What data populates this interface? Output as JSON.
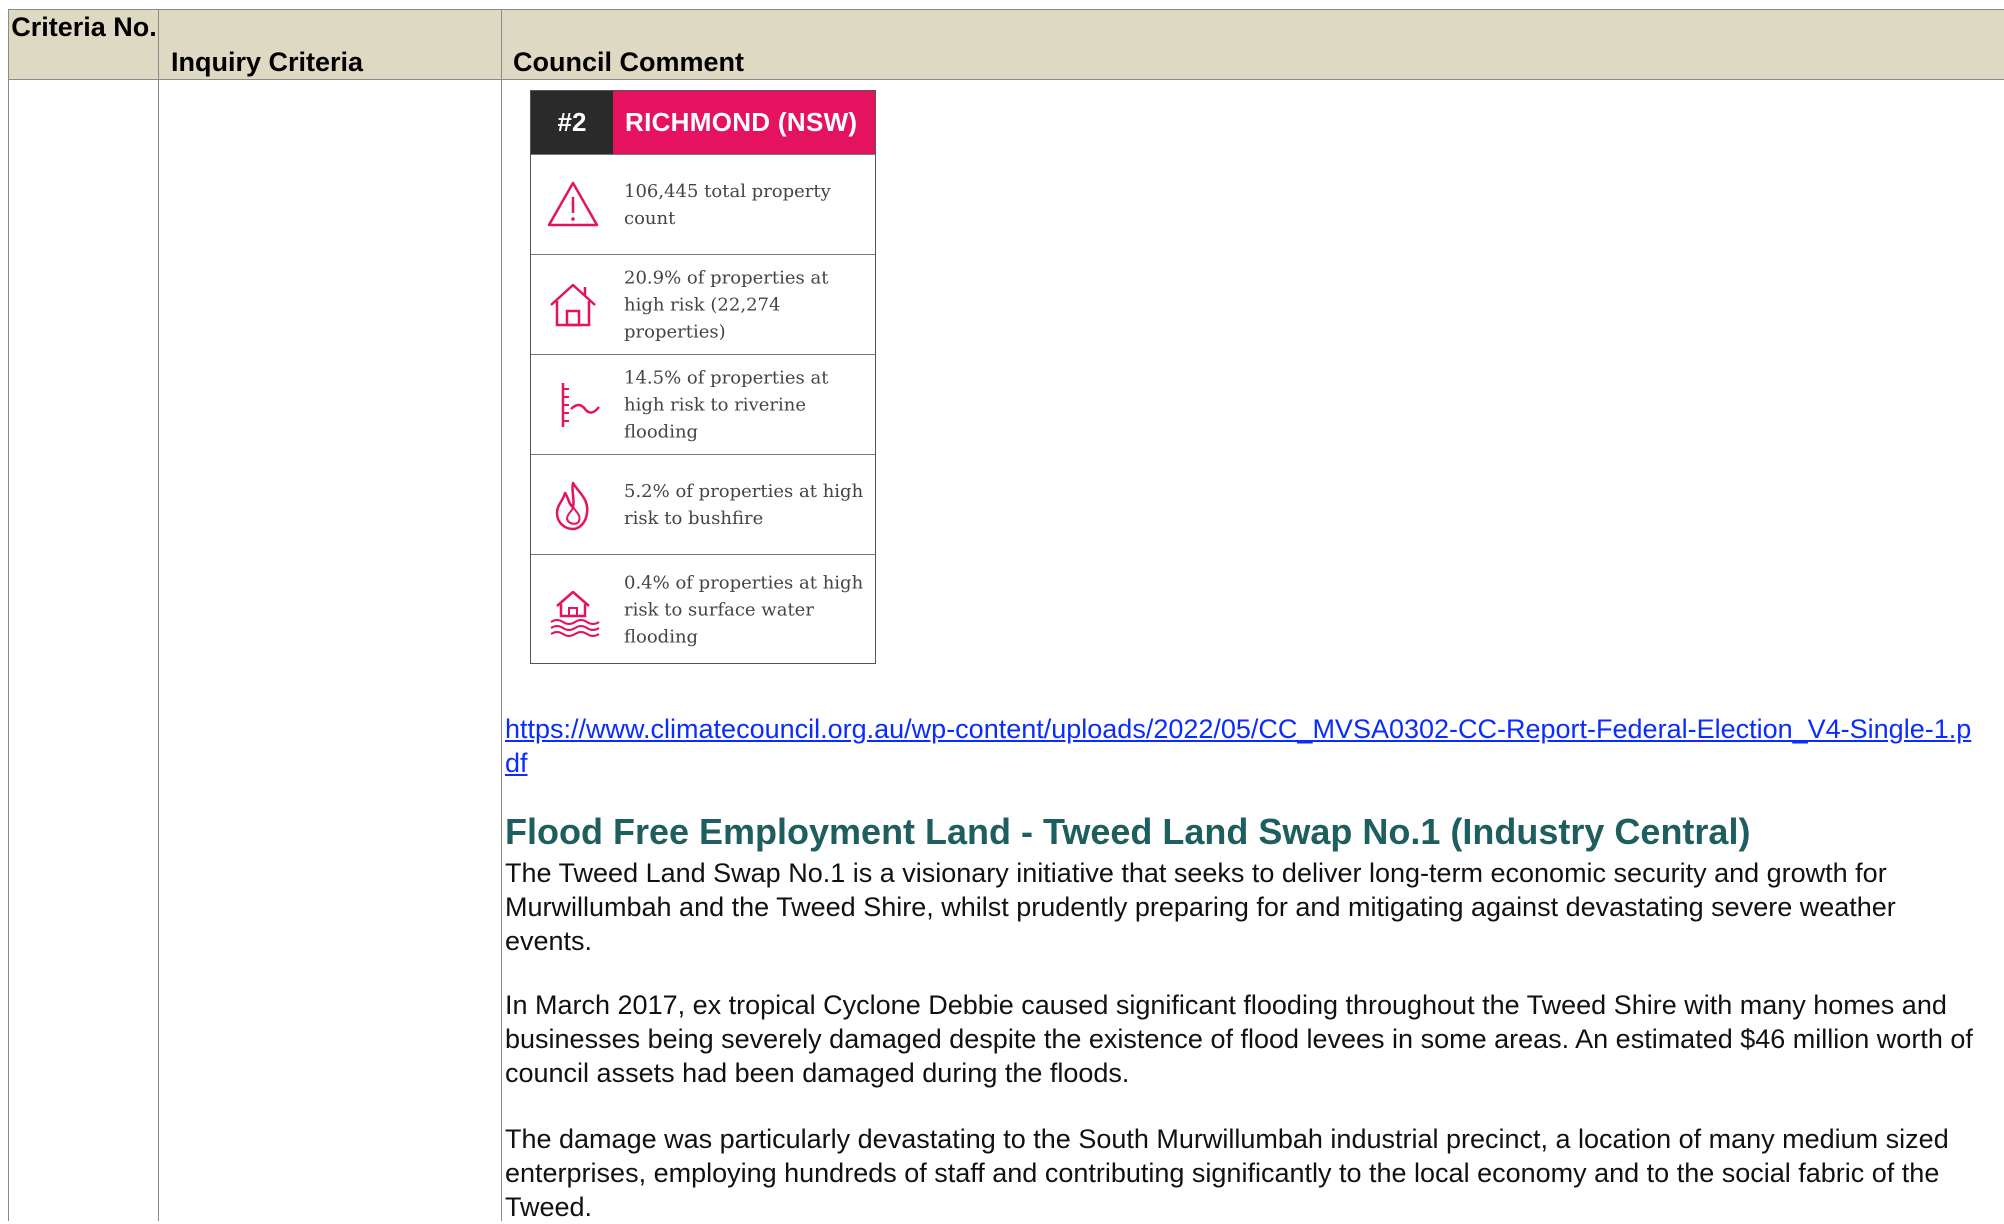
{
  "table": {
    "headers": {
      "criteria_no": "Criteria No.",
      "inquiry_criteria": "Inquiry Criteria",
      "council_comment": "Council Comment"
    }
  },
  "infographic": {
    "rank": "#2",
    "title": "RICHMOND (NSW)",
    "accent_color": "#e5135f",
    "rows": [
      {
        "icon": "warning-triangle-icon",
        "text": "106,445 total property count"
      },
      {
        "icon": "house-icon",
        "text": "20.9% of properties at high risk (22,274 properties)"
      },
      {
        "icon": "riverine-flood-gauge-icon",
        "text": "14.5% of properties at high risk to riverine flooding"
      },
      {
        "icon": "bushfire-flame-icon",
        "text": "5.2% of properties at high risk to bushfire"
      },
      {
        "icon": "surface-water-flood-house-icon",
        "text": "0.4% of properties at high risk to surface water flooding"
      }
    ]
  },
  "link_url": "https://www.climatecouncil.org.au/wp-content/uploads/2022/05/CC_MVSA0302-CC-Report-Federal-Election_V4-Single-1.pdf",
  "section": {
    "heading": "Flood Free Employment Land - Tweed Land Swap No.1 (Industry Central)",
    "paragraphs": [
      "The Tweed Land Swap No.1 is a visionary initiative that seeks to deliver long-term economic security and growth for Murwillumbah and the Tweed Shire, whilst prudently preparing for and mitigating against devastating severe weather events.",
      "In March 2017, ex tropical Cyclone Debbie caused significant flooding throughout the Tweed Shire with many homes and businesses being severely damaged despite the existence of flood levees in some areas. An estimated $46 million worth of council assets had been damaged during the floods.",
      "The damage was particularly devastating to the South Murwillumbah industrial precinct, a location of many medium sized enterprises, employing hundreds of staff and contributing significantly to the local economy and to the social fabric of the Tweed."
    ]
  }
}
